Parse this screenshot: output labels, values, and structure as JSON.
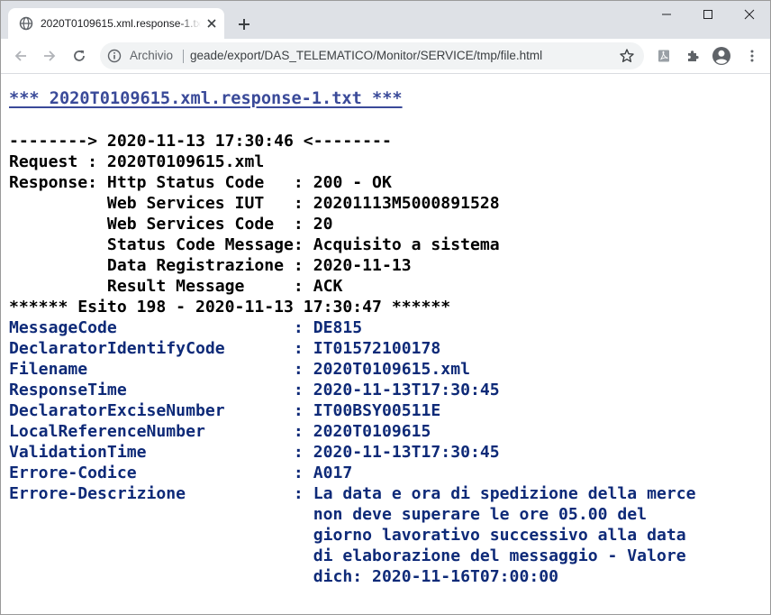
{
  "browser": {
    "tab": {
      "title": "2020T0109615.xml.response-1.txt",
      "favicon": "globe-icon"
    },
    "controls": [
      "minimize-icon",
      "maximize-icon",
      "close-icon"
    ],
    "address": {
      "security_label": "Archivio",
      "url": "geade/export/DAS_TELEMATICO/Monitor/SERVICE/tmp/file.html"
    },
    "toolbar_icons": [
      "back-arrow-icon",
      "forward-arrow-icon",
      "reload-icon",
      "info-icon",
      "star-icon",
      "pdf-extension-icon",
      "puzzle-icon",
      "profile-icon",
      "more-vert-icon"
    ]
  },
  "page": {
    "heading": "*** 2020T0109615.xml.response-1.txt ***",
    "lines": [
      "--------> 2020-11-13 17:30:46 <--------",
      "Request : 2020T0109615.xml",
      "Response: Http Status Code   : 200 - OK",
      "          Web Services IUT   : 20201113M5000891528",
      "          Web Services Code  : 20",
      "          Status Code Message: Acquisito a sistema",
      "          Data Registrazione : 2020-11-13",
      "          Result Message     : ACK",
      "****** Esito 198 - 2020-11-13 17:30:47 ******",
      "MessageCode                  : DE815",
      "DeclaratorIdentifyCode       : IT01572100178",
      "Filename                     : 2020T0109615.xml",
      "ResponseTime                 : 2020-11-13T17:30:45",
      "DeclaratorExciseNumber       : IT00BSY00511E",
      "LocalReferenceNumber         : 2020T0109615",
      "ValidationTime               : 2020-11-13T17:30:45",
      "Errore-Codice                : A017",
      "Errore-Descrizione           : La data e ora di spedizione della merce",
      "                               non deve superare le ore 05.00 del",
      "                               giorno lavorativo successivo alla data",
      "                               di elaborazione del messaggio - Valore",
      "                               dich: 2020-11-16T07:00:00"
    ]
  },
  "colors": {
    "heading": "#3a4a99",
    "text_blue": "#0e2a78",
    "text_black": "#000000",
    "tabbar_bg": "#dee1e6",
    "omnibox_bg": "#f1f3f4"
  }
}
